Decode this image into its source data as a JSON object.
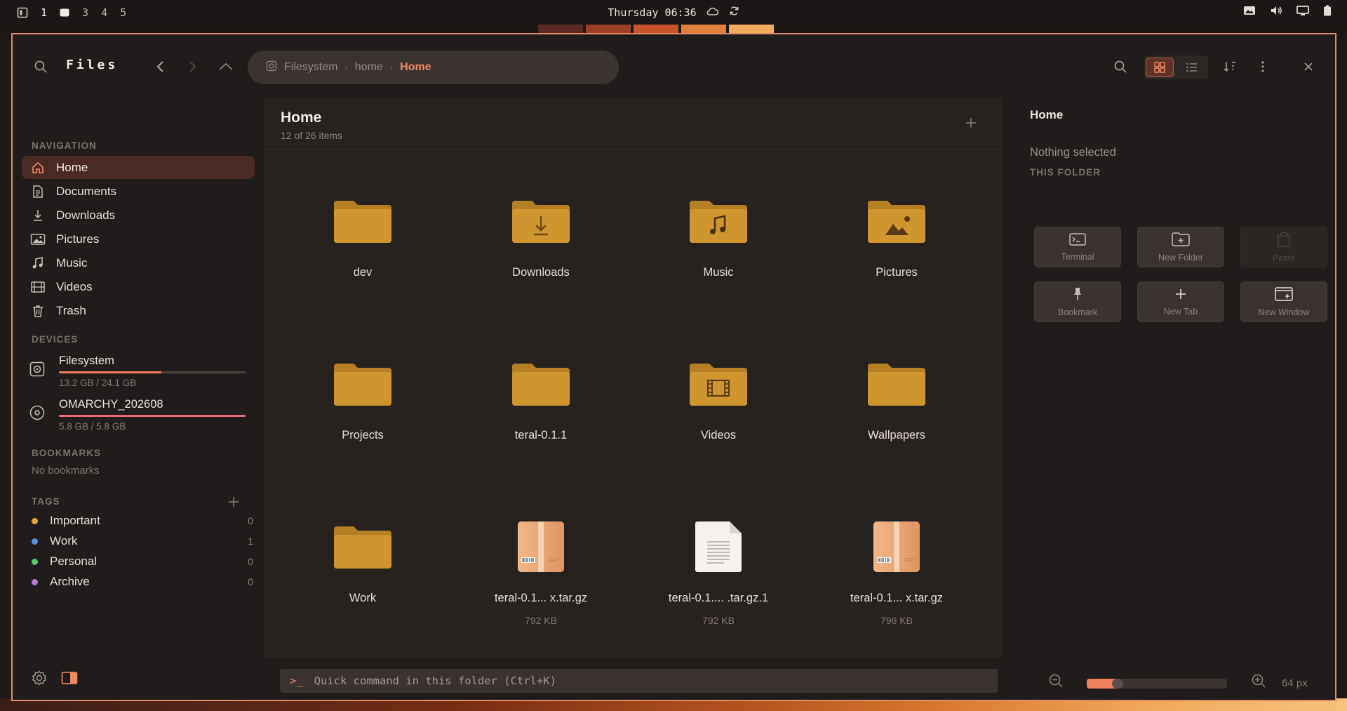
{
  "topbar": {
    "workspaces": [
      "1",
      "3",
      "4",
      "5"
    ],
    "clock": "Thursday 06:36",
    "icons": [
      "workspace-overview-icon",
      "cloud-icon",
      "sync-icon",
      "screenshot-icon",
      "volume-icon",
      "display-icon",
      "battery-icon"
    ],
    "stripe_colors": [
      "#5a2a22",
      "#9c4026",
      "#c8552a",
      "#e0803c",
      "#f0ab5e"
    ]
  },
  "header": {
    "title": "Files",
    "breadcrumb": [
      "Filesystem",
      "home",
      "Home"
    ]
  },
  "sidebar": {
    "navigation_label": "NAVIGATION",
    "nav_items": [
      {
        "label": "Home",
        "icon": "home-icon"
      },
      {
        "label": "Documents",
        "icon": "document-icon"
      },
      {
        "label": "Downloads",
        "icon": "download-icon"
      },
      {
        "label": "Pictures",
        "icon": "picture-icon"
      },
      {
        "label": "Music",
        "icon": "music-icon"
      },
      {
        "label": "Videos",
        "icon": "video-icon"
      },
      {
        "label": "Trash",
        "icon": "trash-icon"
      }
    ],
    "devices_label": "DEVICES",
    "devices": [
      {
        "name": "Filesystem",
        "size": "13.2 GB / 24.1 GB",
        "usage": 0.548
      },
      {
        "name": "OMARCHY_202608",
        "size": "5.8 GB / 5.8 GB",
        "usage": 1.0
      }
    ],
    "bookmarks_label": "BOOKMARKS",
    "no_bookmarks": "No bookmarks",
    "tags_label": "TAGS",
    "tags": [
      {
        "name": "Important",
        "count": "0",
        "color": "#e8a33c"
      },
      {
        "name": "Work",
        "count": "1",
        "color": "#5b8fe0"
      },
      {
        "name": "Personal",
        "count": "0",
        "color": "#5fc46a"
      },
      {
        "name": "Archive",
        "count": "0",
        "color": "#b97ad8"
      }
    ]
  },
  "main": {
    "title": "Home",
    "subtitle": "12 of 26 items",
    "items": [
      {
        "name": "dev",
        "type": "folder",
        "size": ""
      },
      {
        "name": "Downloads",
        "type": "folder-downloads",
        "size": ""
      },
      {
        "name": "Music",
        "type": "folder-music",
        "size": ""
      },
      {
        "name": "Pictures",
        "type": "folder-pictures",
        "size": ""
      },
      {
        "name": "Projects",
        "type": "folder",
        "size": ""
      },
      {
        "name": "teral-0.1.1",
        "type": "folder",
        "size": ""
      },
      {
        "name": "Videos",
        "type": "folder-videos",
        "size": ""
      },
      {
        "name": "Wallpapers",
        "type": "folder",
        "size": ""
      },
      {
        "name": "Work",
        "type": "folder",
        "size": ""
      },
      {
        "name": "teral-0.1... x.tar.gz",
        "type": "archive",
        "size": "792 KB"
      },
      {
        "name": "teral-0.1.... .tar.gz.1",
        "type": "text",
        "size": "792 KB"
      },
      {
        "name": "teral-0.1... x.tar.gz",
        "type": "archive",
        "size": "796 KB"
      }
    ],
    "quick_command": {
      "prompt": ">_",
      "placeholder": "Quick command in this folder (Ctrl+K)"
    }
  },
  "right_panel": {
    "title": "Home",
    "nothing_selected": "Nothing selected",
    "section_label": "THIS FOLDER",
    "actions": [
      {
        "label": "Terminal",
        "icon": "terminal-icon",
        "enabled": true
      },
      {
        "label": "New Folder",
        "icon": "new-folder-icon",
        "enabled": true
      },
      {
        "label": "Paste",
        "icon": "paste-icon",
        "enabled": false
      },
      {
        "label": "Bookmark",
        "icon": "pin-icon",
        "enabled": true
      },
      {
        "label": "New Tab",
        "icon": "plus-icon",
        "enabled": true
      },
      {
        "label": "New Window",
        "icon": "new-window-icon",
        "enabled": true
      }
    ],
    "zoom": {
      "label": "64 px",
      "level": 0.22
    }
  },
  "colors": {
    "accent": "#ef8a63",
    "folder": "#c98f2c",
    "border": "#e08b68"
  }
}
